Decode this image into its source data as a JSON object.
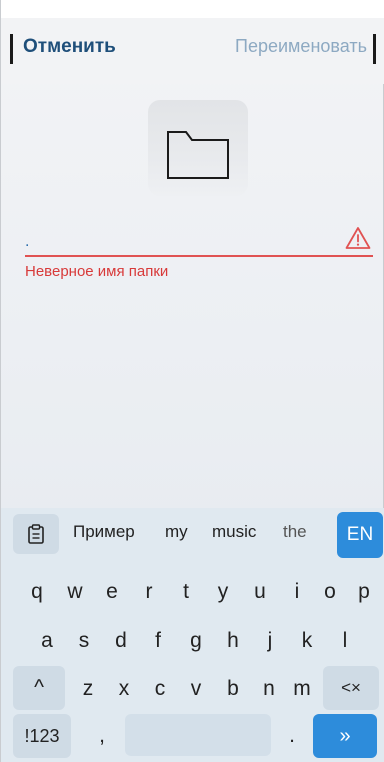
{
  "header": {
    "cancel_label": "Отменить",
    "rename_label": "Переименовать"
  },
  "folder": {
    "icon": "folder-icon"
  },
  "name_field": {
    "value": ".",
    "error": "Неверное имя папки",
    "error_color": "#d83a3a"
  },
  "keyboard": {
    "suggestions": [
      "Пример",
      "my",
      "music",
      "the"
    ],
    "language_label": "EN",
    "row1": [
      "q",
      "w",
      "e",
      "r",
      "t",
      "y",
      "u",
      "i",
      "o",
      "p"
    ],
    "row2": [
      "a",
      "s",
      "d",
      "f",
      "g",
      "h",
      "j",
      "k",
      "l"
    ],
    "row3": [
      "z",
      "x",
      "c",
      "v",
      "b",
      "n",
      "m"
    ],
    "shift_symbol": "^",
    "backspace_symbol": "<×",
    "symbols_label": "!123",
    "comma_label": ",",
    "period_label": ".",
    "enter_symbol": "»",
    "accent_color": "#2d8cdb"
  }
}
